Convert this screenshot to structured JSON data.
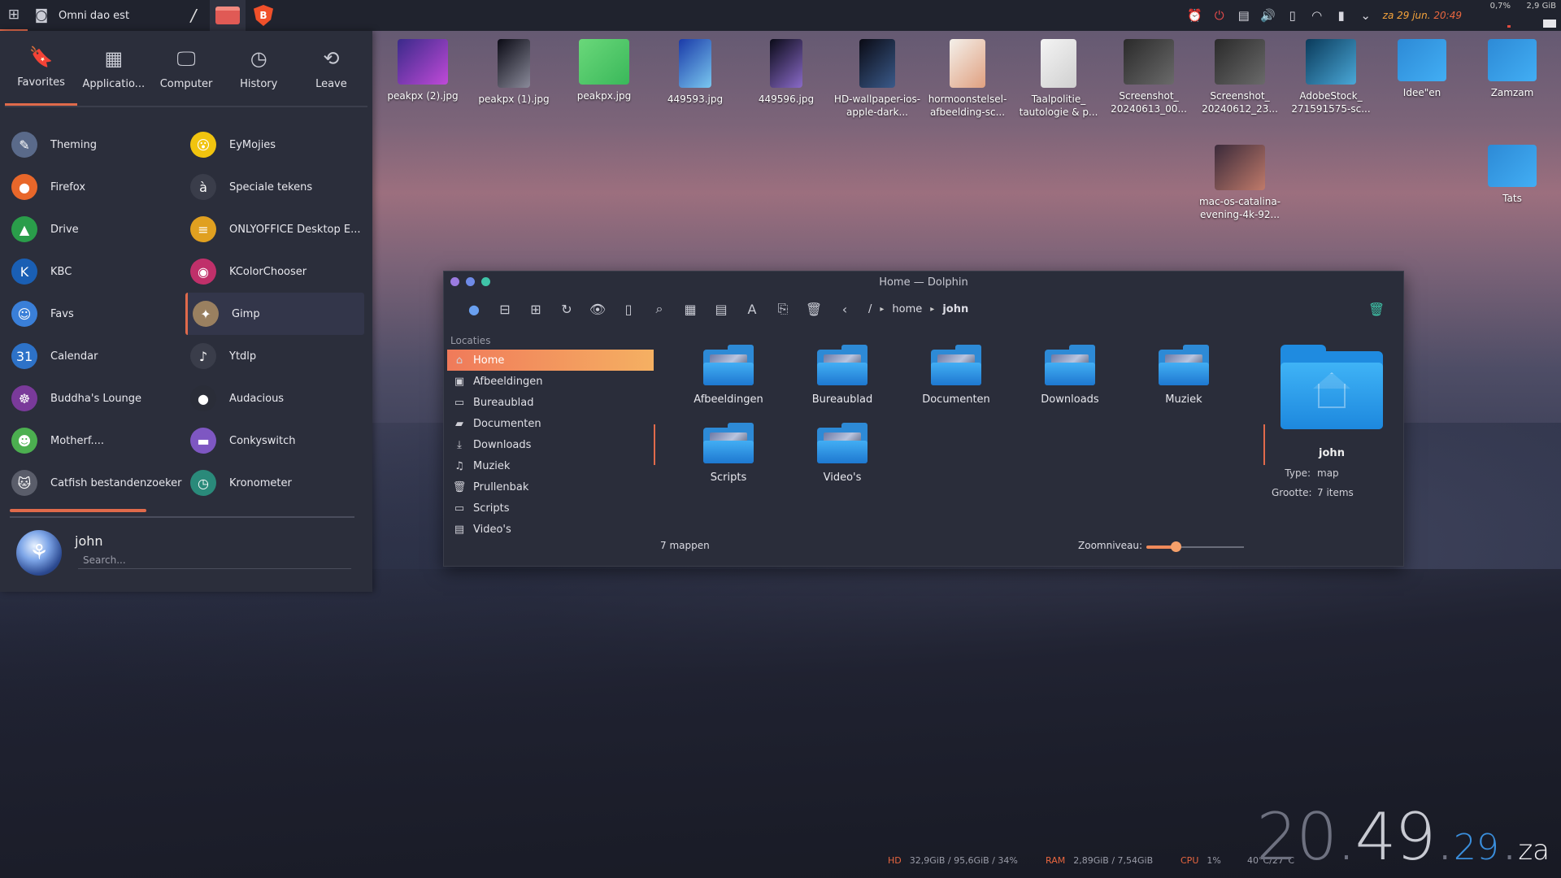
{
  "topbar": {
    "window_title": "Omni dao est",
    "slash": "/",
    "tray_date": "za 29 jun.",
    "tray_time": "20:49",
    "cpu_pct": "0,7%",
    "mem": "2,9 GiB",
    "cpu_level": 0.1,
    "mem_level": 0.4
  },
  "launcher": {
    "tabs": [
      {
        "label": "Favorites",
        "icon": "bookmark-icon"
      },
      {
        "label": "Applicatio...",
        "icon": "grid-icon"
      },
      {
        "label": "Computer",
        "icon": "monitor-icon"
      },
      {
        "label": "History",
        "icon": "clock-icon"
      },
      {
        "label": "Leave",
        "icon": "back-icon"
      }
    ],
    "apps": [
      {
        "label": "Theming",
        "color": "#5a6a8a",
        "glyph": "✎"
      },
      {
        "label": "EyMojies",
        "color": "#f1c40f",
        "glyph": "😮"
      },
      {
        "label": "Firefox",
        "color": "#e8672a",
        "glyph": "●"
      },
      {
        "label": "Speciale tekens",
        "color": "#3a3d4a",
        "glyph": "à"
      },
      {
        "label": "Drive",
        "color": "#2a9d4a",
        "glyph": "▲"
      },
      {
        "label": "ONLYOFFICE Desktop E...",
        "color": "#e0a020",
        "glyph": "≡"
      },
      {
        "label": "KBC",
        "color": "#1a5fb4",
        "glyph": "K"
      },
      {
        "label": "KColorChooser",
        "color": "#c0306a",
        "glyph": "◉"
      },
      {
        "label": "Favs",
        "color": "#3a7fd8",
        "glyph": "☺"
      },
      {
        "label": "Gimp",
        "color": "#9a8060",
        "glyph": "✦"
      },
      {
        "label": "Calendar",
        "color": "#2d72c8",
        "glyph": "31"
      },
      {
        "label": "Ytdlp",
        "color": "#3a3d4a",
        "glyph": "♪"
      },
      {
        "label": "Buddha's Lounge",
        "color": "#7a3a9a",
        "glyph": "☸"
      },
      {
        "label": "Audacious",
        "color": "#2a2d38",
        "glyph": "●"
      },
      {
        "label": "Motherf....",
        "color": "#4caf50",
        "glyph": "☻"
      },
      {
        "label": "Conkyswitch",
        "color": "#7e57c2",
        "glyph": "▬"
      },
      {
        "label": "Catfish bestandenzoeker",
        "color": "#5a5d6a",
        "glyph": "🐱"
      },
      {
        "label": "Kronometer",
        "color": "#2a8a7a",
        "glyph": "◷"
      }
    ],
    "user": "john",
    "search_placeholder": "Search..."
  },
  "desktop": [
    {
      "label": "peakpx (2).jpg",
      "colors": [
        "#3a2a8a",
        "#c04ad8"
      ]
    },
    {
      "label": "peakpx (1).jpg",
      "colors": [
        "#0a0a14",
        "#8a8a9a"
      ]
    },
    {
      "label": "peakpx.jpg",
      "colors": [
        "#6ad87a",
        "#3ab85a"
      ]
    },
    {
      "label": "449593.jpg",
      "colors": [
        "#1a3aa8",
        "#7ac8f0"
      ]
    },
    {
      "label": "449596.jpg",
      "colors": [
        "#0a0a18",
        "#8a6ac8"
      ]
    },
    {
      "label": "HD-wallpaper-ios-apple-dark...",
      "colors": [
        "#0a0a14",
        "#3a5a8a"
      ]
    },
    {
      "label": "hormoonstelsel-afbeelding-sc...",
      "colors": [
        "#f4f0ea",
        "#e0a080"
      ]
    },
    {
      "label": "Taalpolitie_ tautologie & p...",
      "colors": [
        "#f4f4f4",
        "#d0d0d0"
      ]
    },
    {
      "label": "Screenshot_ 20240613_00...",
      "colors": [
        "#2a2a2a",
        "#6a6a6a"
      ]
    },
    {
      "label": "Screenshot_ 20240612_23...",
      "colors": [
        "#2a2a2a",
        "#6a6a6a"
      ]
    },
    {
      "label": "AdobeStock_ 271591575-sc...",
      "colors": [
        "#0a3a5a",
        "#4aa8d8"
      ]
    },
    {
      "label": "Idee\"en",
      "colors": [
        "#2d8ad6",
        "#42aef4"
      ]
    },
    {
      "label": "Zamzam",
      "colors": [
        "#2d8ad6",
        "#42aef4"
      ]
    },
    {
      "label": "mac-os-catalina-evening-4k-92...",
      "colors": [
        "#3a2a3a",
        "#c07a6a"
      ]
    },
    {
      "label": "Tats",
      "colors": [
        "#2d8ad6",
        "#42aef4"
      ]
    }
  ],
  "dolphin": {
    "title": "Home — Dolphin",
    "breadcrumb": [
      "/",
      "home",
      "john"
    ],
    "places_header": "Locaties",
    "places": [
      {
        "label": "Home",
        "icon": "home-icon",
        "glyph": "⌂"
      },
      {
        "label": "Afbeeldingen",
        "icon": "image-icon",
        "glyph": "▣"
      },
      {
        "label": "Bureaublad",
        "icon": "desktop-icon",
        "glyph": "▭"
      },
      {
        "label": "Documenten",
        "icon": "folder-icon",
        "glyph": "▰"
      },
      {
        "label": "Downloads",
        "icon": "download-icon",
        "glyph": "⤓"
      },
      {
        "label": "Muziek",
        "icon": "music-icon",
        "glyph": "♫"
      },
      {
        "label": "Prullenbak",
        "icon": "trash-icon",
        "glyph": "🗑"
      },
      {
        "label": "Scripts",
        "icon": "folder-icon",
        "glyph": "▭"
      },
      {
        "label": "Video's",
        "icon": "video-icon",
        "glyph": "▤"
      }
    ],
    "files": [
      "Afbeeldingen",
      "Bureaublad",
      "Documenten",
      "Downloads",
      "Muziek",
      "Scripts",
      "Video's"
    ],
    "info": {
      "name": "john",
      "type_label": "Type:",
      "type_value": "map",
      "size_label": "Grootte:",
      "size_value": "7 items"
    },
    "status_count": "7 mappen",
    "zoom_label": "Zoomniveau:",
    "zoom_level": 0.3
  },
  "conky": {
    "hd_label": "HD",
    "hd_value": "32,9GiB / 95,6GiB / 34%",
    "ram_label": "RAM",
    "ram_value": "2,89GiB / 7,54GiB",
    "cpu_label": "CPU",
    "cpu_value": "1%",
    "temp_value": "40°C/27°C"
  },
  "clock": {
    "hh": "20",
    "mm": "49",
    "ss": "29",
    "day": "za"
  }
}
